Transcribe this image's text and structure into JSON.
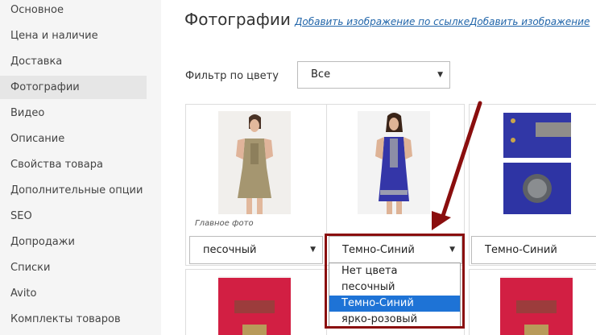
{
  "sidebar": {
    "items": [
      {
        "label": "Основное"
      },
      {
        "label": "Цена и наличие"
      },
      {
        "label": "Доставка"
      },
      {
        "label": "Фотографии",
        "active": true
      },
      {
        "label": "Видео"
      },
      {
        "label": "Описание"
      },
      {
        "label": "Свойства товара"
      },
      {
        "label": "Дополнительные опции"
      },
      {
        "label": "SEO"
      },
      {
        "label": "Допродажи"
      },
      {
        "label": "Списки"
      },
      {
        "label": "Avito"
      },
      {
        "label": "Комплекты товаров"
      }
    ]
  },
  "header": {
    "title": "Фотографии",
    "add_by_link": "Добавить изображение по ссылке",
    "add_image": "Добавить изображение"
  },
  "filter": {
    "label": "Фильтр по цвету",
    "value": "Все"
  },
  "photos": [
    {
      "caption": "Главное фото",
      "color": "песочный"
    },
    {
      "color": "Темно-Синий"
    },
    {
      "color": "Темно-Синий"
    }
  ],
  "dropdown": {
    "options": [
      "Нет цвета",
      "песочный",
      "Темно-Синий",
      "ярко-розовый"
    ],
    "selected_index": 2
  },
  "colors": {
    "link": "#2266aa",
    "selected_option": "#1e73d6",
    "annotation": "#8a0e0e",
    "sidebar_bg": "#f5f5f5"
  }
}
